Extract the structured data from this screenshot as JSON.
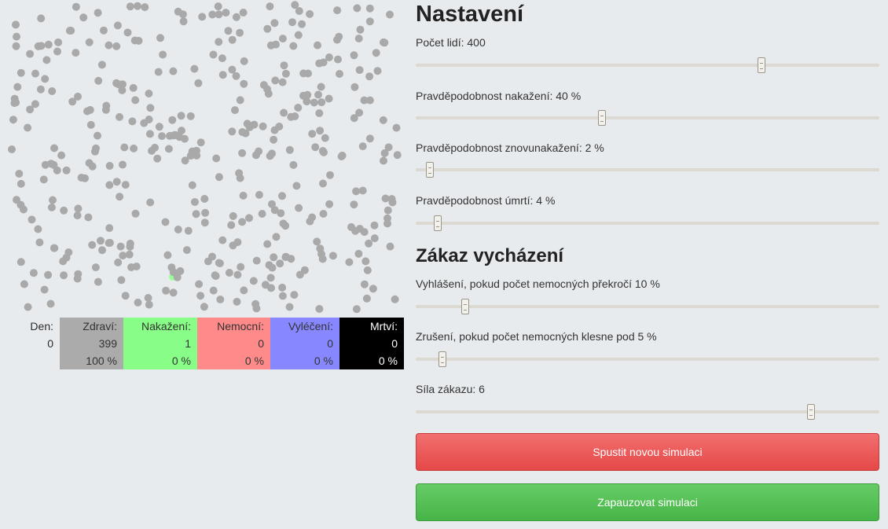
{
  "simulation": {
    "population": 400,
    "healthy_color": "#a9a9a9",
    "infected_color": "#99ff99"
  },
  "stats": {
    "den": {
      "label": "Den:",
      "value": "0",
      "percent": ""
    },
    "zdravi": {
      "label": "Zdraví:",
      "value": "399",
      "percent": "100 %",
      "color": "#ababab"
    },
    "nakazeni": {
      "label": "Nakažení:",
      "value": "1",
      "percent": "0 %",
      "color": "#88fd88"
    },
    "nemocni": {
      "label": "Nemocní:",
      "value": "0",
      "percent": "0 %",
      "color": "#ff8a8a"
    },
    "vyleceni": {
      "label": "Vyléčení:",
      "value": "0",
      "percent": "0 %",
      "color": "#8787ff"
    },
    "mrtvi": {
      "label": "Mrtví:",
      "value": "0",
      "percent": "0 %",
      "color": "#000000"
    }
  },
  "settings": {
    "title": "Nastavení",
    "sliders": [
      {
        "label": "Počet lidí: 400",
        "fraction": 0.745
      },
      {
        "label": "Pravděpodobnost nakažení: 40 %",
        "fraction": 0.402
      },
      {
        "label": "Pravděpodobnost znovunakažení: 2 %",
        "fraction": 0.03
      },
      {
        "label": "Pravděpodobnost úmrtí: 4 %",
        "fraction": 0.048
      }
    ]
  },
  "lockdown": {
    "title": "Zákaz vycházení",
    "sliders": [
      {
        "label": "Vyhlášení, pokud počet nemocných překročí 10 %",
        "fraction": 0.107
      },
      {
        "label": "Zrušení, pokud počet nemocných klesne pod 5 %",
        "fraction": 0.058
      },
      {
        "label": "Síla zákazu: 6",
        "fraction": 0.852
      }
    ]
  },
  "buttons": {
    "restart": "Spustit novou simulaci",
    "pause": "Zapauzovat simulaci"
  },
  "colors": {
    "restart_button": "#ea5a5a",
    "pause_button": "#55be55"
  }
}
